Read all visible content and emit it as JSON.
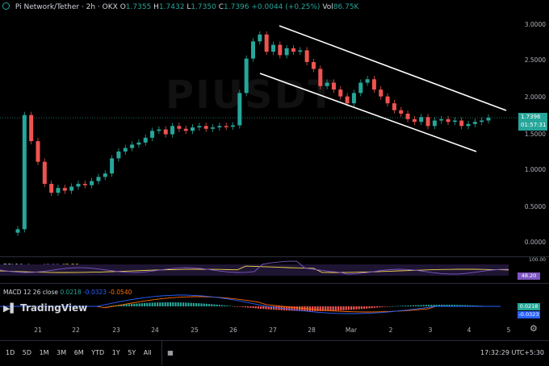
{
  "header": {
    "pair": "Pi Network/Tether · 2h · OKX",
    "o_label": "O",
    "o": "1.7355",
    "h_label": "H",
    "h": "1.7432",
    "l_label": "L",
    "l": "1.7350",
    "c_label": "C",
    "c": "1.7396",
    "change": "+0.0044 (+0.25%)",
    "vol_label": "Vol",
    "vol": "86.75K"
  },
  "watermark": "PIUSDT",
  "price_axis": {
    "ticks": [
      "3.0000",
      "2.5000",
      "2.0000",
      "1.5000",
      "1.0000",
      "0.5000",
      "0.0000"
    ],
    "current_price": "1.7396",
    "countdown": "01:57:31"
  },
  "rsi": {
    "label": "RSI 14 close",
    "value_a": "48.20",
    "value_b": "45.26",
    "axis_top": "100.00",
    "tag": "48.20"
  },
  "macd": {
    "label": "MACD 12 26 close",
    "v1": "0.0218",
    "v2": "-0.0323",
    "v3": "-0.0540",
    "tag_a": "0.0218",
    "tag_b": "-0.0323"
  },
  "logo": "TradingView",
  "time_axis": {
    "ticks": [
      "21",
      "22",
      "23",
      "24",
      "25",
      "26",
      "27",
      "28",
      "Mar",
      "2",
      "3",
      "4",
      "5"
    ]
  },
  "timeframes": [
    "1D",
    "5D",
    "1M",
    "3M",
    "6M",
    "YTD",
    "1Y",
    "5Y",
    "All"
  ],
  "clock": "17:32:29 UTC+5:30",
  "colors": {
    "up": "#26a69a",
    "down": "#ef5350",
    "rsi": "#7e57c2",
    "macd": "#2962ff",
    "signal": "#ff6d00"
  },
  "icons": {
    "calendar": "calendar-icon",
    "settings": "gear-icon"
  },
  "chart_data": {
    "type": "candlestick",
    "ylim": [
      0,
      3.1
    ],
    "closes": [
      0.12,
      1.78,
      1.4,
      1.1,
      0.78,
      0.65,
      0.72,
      0.68,
      0.74,
      0.78,
      0.76,
      0.82,
      0.88,
      0.93,
      1.15,
      1.25,
      1.3,
      1.35,
      1.38,
      1.45,
      1.55,
      1.57,
      1.5,
      1.62,
      1.58,
      1.55,
      1.6,
      1.62,
      1.58,
      1.6,
      1.62,
      1.61,
      1.63,
      2.1,
      2.6,
      2.85,
      2.95,
      2.7,
      2.8,
      2.65,
      2.75,
      2.7,
      2.72,
      2.55,
      2.45,
      2.2,
      2.25,
      2.15,
      2.05,
      1.95,
      2.1,
      2.25,
      2.3,
      2.15,
      2.05,
      1.95,
      1.85,
      1.8,
      1.72,
      1.68,
      1.75,
      1.62,
      1.7,
      1.72,
      1.68,
      1.7,
      1.62,
      1.65,
      1.68,
      1.7,
      1.74
    ]
  }
}
